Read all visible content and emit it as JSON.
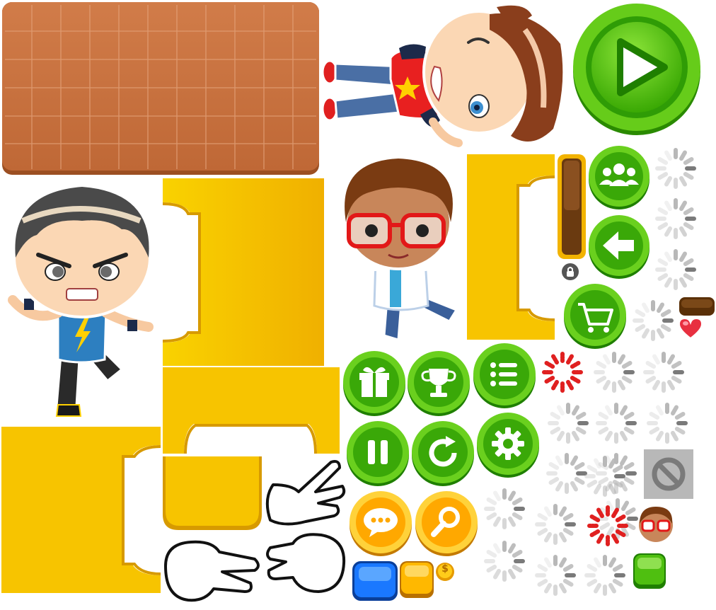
{
  "sheet": {
    "kind": "game-ui-sprite-sheet",
    "background": "#ffffff",
    "style_colors": {
      "brick": "#c8713f",
      "brick_grout": "#e5996a",
      "gold": "#f7c400",
      "gold_dark": "#d79a00",
      "green": "#4fbf10",
      "green_dark": "#1f7f00",
      "orange": "#ffb800",
      "blue": "#1a78ff",
      "spinner_gray": "#b8b8b8",
      "spinner_red": "#e02020",
      "heart": "#e83040",
      "brown_bar": "#6a3a10"
    }
  },
  "characters": [
    {
      "id": "boy-winking-lying",
      "shirt": "#e82020",
      "hair": "#8a3e1c"
    },
    {
      "id": "boy-angry-lightning",
      "shirt": "#2d7fc0",
      "hair": "#3a3a3a"
    },
    {
      "id": "boy-glasses-jumping",
      "shirt": "#ffffff",
      "hair": "#7a3b12"
    }
  ],
  "buttons": {
    "play": {
      "icon": "play-icon"
    },
    "round_green": [
      {
        "icon": "users-icon"
      },
      {
        "icon": "back-arrow-icon"
      },
      {
        "icon": "shop-cart-icon"
      },
      {
        "icon": "gift-icon"
      },
      {
        "icon": "trophy-icon"
      },
      {
        "icon": "menu-list-icon"
      },
      {
        "icon": "pause-icon"
      },
      {
        "icon": "restart-icon"
      },
      {
        "icon": "settings-gear-icon"
      }
    ],
    "round_orange": [
      {
        "icon": "chat-bubble-icon"
      },
      {
        "icon": "magnifier-icon"
      }
    ]
  },
  "coin": {
    "symbol": "$"
  },
  "spinners": {
    "count_gray": 18,
    "count_red": 2
  }
}
